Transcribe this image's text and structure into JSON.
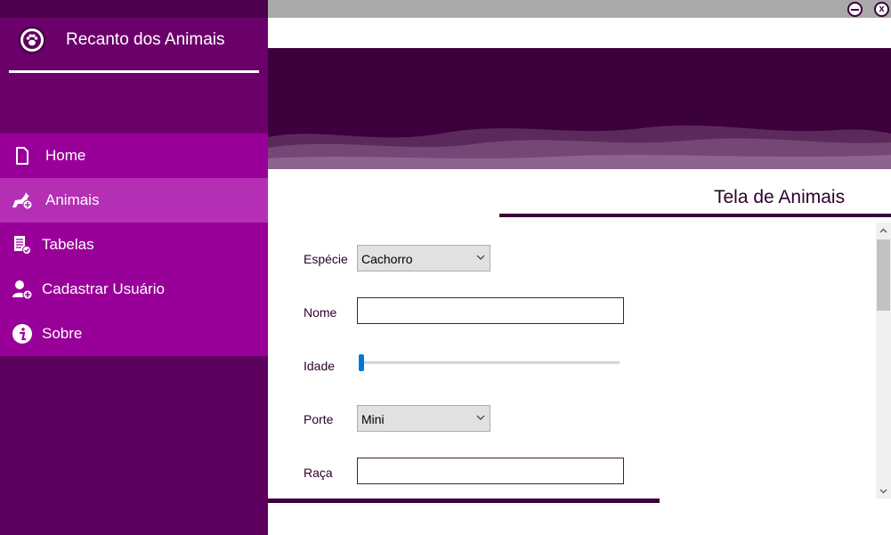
{
  "app": {
    "title": "Recanto dos Animais"
  },
  "sidebar": {
    "items": [
      {
        "label": "Home",
        "icon": "document-icon"
      },
      {
        "label": "Animais",
        "icon": "dog-add-icon",
        "active": true
      },
      {
        "label": "Tabelas",
        "icon": "table-check-icon"
      },
      {
        "label": "Cadastrar Usuário",
        "icon": "user-add-icon"
      },
      {
        "label": "Sobre",
        "icon": "info-icon"
      }
    ]
  },
  "window": {
    "minimize_symbol": "–",
    "close_symbol": "x"
  },
  "screen": {
    "title": "Tela de Animais"
  },
  "form": {
    "especie": {
      "label": "Espécie",
      "value": "Cachorro"
    },
    "nome": {
      "label": "Nome",
      "value": ""
    },
    "idade": {
      "label": "Idade",
      "value": 0
    },
    "porte": {
      "label": "Porte",
      "value": "Mini"
    },
    "raca": {
      "label": "Raça",
      "value": ""
    }
  },
  "colors": {
    "sidebar": "#5e005e",
    "menu": "#990099",
    "menu_active": "#b52fb5",
    "banner": "#3c003c",
    "accent": "#0078d7"
  }
}
